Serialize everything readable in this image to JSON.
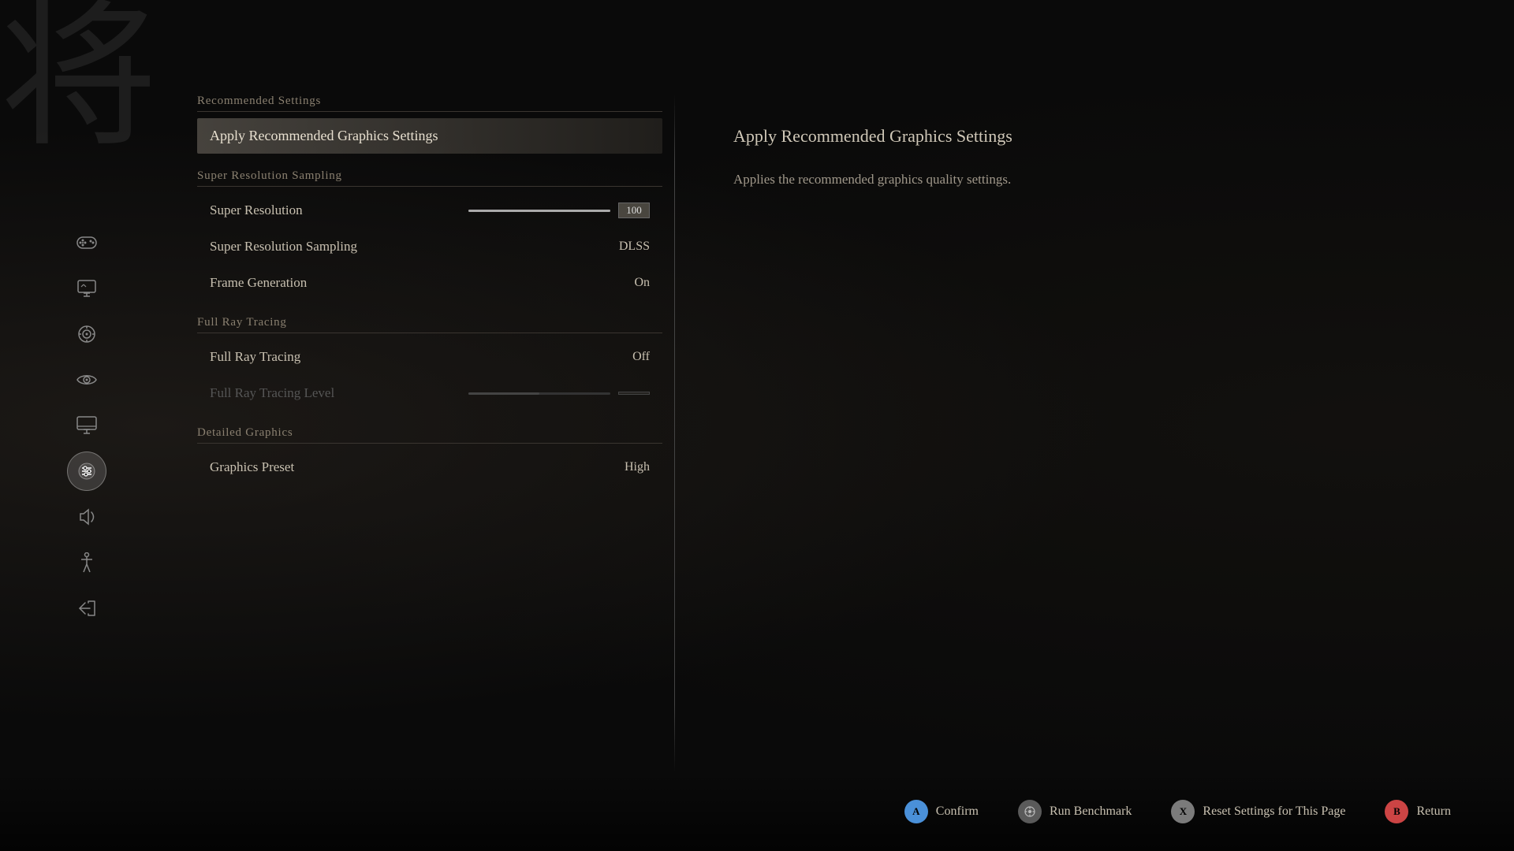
{
  "background": {
    "kanji": "将"
  },
  "sidebar": {
    "items": [
      {
        "id": "gamepad",
        "icon": "🎮",
        "active": false
      },
      {
        "id": "display",
        "icon": "⊞",
        "active": false
      },
      {
        "id": "graphics-target",
        "icon": "◎",
        "active": false
      },
      {
        "id": "eye",
        "icon": "👁",
        "active": false
      },
      {
        "id": "monitor",
        "icon": "🖥",
        "active": false
      },
      {
        "id": "sliders",
        "icon": "⊕",
        "active": true
      },
      {
        "id": "audio",
        "icon": "◁▷",
        "active": false
      },
      {
        "id": "accessibility",
        "icon": "✦",
        "active": false
      },
      {
        "id": "exit",
        "icon": "↩",
        "active": false
      }
    ]
  },
  "sections": [
    {
      "id": "recommended",
      "header": "Recommended Settings",
      "items": [
        {
          "id": "apply-recommended",
          "label": "Apply Recommended Graphics Settings",
          "value": "",
          "selected": true,
          "disabled": false
        }
      ]
    },
    {
      "id": "super-resolution-sampling",
      "header": "Super Resolution Sampling",
      "items": [
        {
          "id": "super-resolution",
          "label": "Super Resolution",
          "value": "100",
          "is_slider": true,
          "slider_max": 100,
          "slider_current": 100,
          "selected": false,
          "disabled": false
        },
        {
          "id": "super-resolution-sampling",
          "label": "Super Resolution Sampling",
          "value": "DLSS",
          "is_slider": false,
          "selected": false,
          "disabled": false
        },
        {
          "id": "frame-generation",
          "label": "Frame Generation",
          "value": "On",
          "is_slider": false,
          "selected": false,
          "disabled": false
        }
      ]
    },
    {
      "id": "full-ray-tracing",
      "header": "Full Ray Tracing",
      "items": [
        {
          "id": "full-ray-tracing",
          "label": "Full Ray Tracing",
          "value": "Off",
          "is_slider": false,
          "selected": false,
          "disabled": false
        },
        {
          "id": "full-ray-tracing-level",
          "label": "Full Ray Tracing Level",
          "value": "",
          "is_slider": true,
          "slider_max": 100,
          "slider_current": 50,
          "selected": false,
          "disabled": true
        }
      ]
    },
    {
      "id": "detailed-graphics",
      "header": "Detailed Graphics",
      "items": [
        {
          "id": "graphics-preset",
          "label": "Graphics Preset",
          "value": "High",
          "is_slider": false,
          "selected": false,
          "disabled": false
        }
      ]
    }
  ],
  "info_panel": {
    "title": "Apply Recommended Graphics Settings",
    "description": "Applies the recommended graphics quality settings."
  },
  "bottom_bar": {
    "actions": [
      {
        "id": "confirm",
        "button": "A",
        "label": "Confirm",
        "button_style": "btn-a"
      },
      {
        "id": "run-benchmark",
        "button": "⚙",
        "label": "Run Benchmark",
        "button_style": "benchmark"
      },
      {
        "id": "reset-settings",
        "button": "X",
        "label": "Reset Settings for This Page",
        "button_style": "btn-x"
      },
      {
        "id": "return",
        "button": "B",
        "label": "Return",
        "button_style": "btn-b"
      }
    ]
  }
}
